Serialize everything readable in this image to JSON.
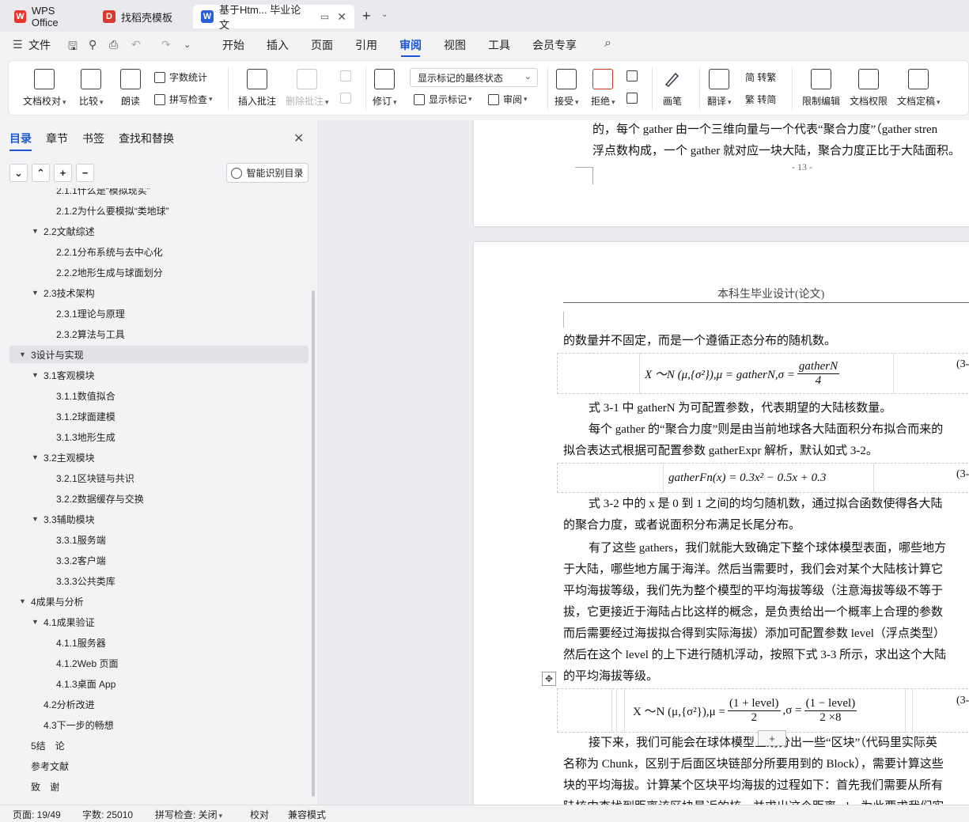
{
  "tabs": [
    {
      "label": "WPS Office",
      "icon": "wps-logo-icon"
    },
    {
      "label": "找稻壳模板",
      "icon": "docer-logo-icon"
    },
    {
      "label": "基于Htm... 毕业论文",
      "icon": "word-doc-icon"
    }
  ],
  "menu": {
    "file": "文件",
    "items": [
      "开始",
      "插入",
      "页面",
      "引用",
      "审阅",
      "视图",
      "工具",
      "会员专享"
    ],
    "active": "审阅"
  },
  "ribbon": {
    "doc_proofread": "文档校对",
    "compare": "比较",
    "read_aloud": "朗读",
    "word_count": "字数统计",
    "spell_check": "拼写检查",
    "insert_comment": "插入批注",
    "delete_comment": "删除批注",
    "revise": "修订",
    "markup_mode": "显示标记的最终状态",
    "show_markup": "显示标记",
    "review": "审阅",
    "accept": "接受",
    "reject": "拒绝",
    "pen": "画笔",
    "translate": "翻译",
    "to_traditional": "简 转繁",
    "to_simplified": "繁 转简",
    "restrict_edit": "限制编辑",
    "doc_permission": "文档权限",
    "doc_finalize": "文档定稿"
  },
  "sidebar": {
    "tabs": [
      "目录",
      "章节",
      "书签",
      "查找和替换"
    ],
    "active_tab": "目录",
    "smart_toc": "智能识别目录",
    "toc": [
      {
        "label": "2.1.1什么是“模拟现实”",
        "level": 3
      },
      {
        "label": "2.1.2为什么要模拟“类地球”",
        "level": 3
      },
      {
        "label": "2.2文献综述",
        "level": 2,
        "expanded": true
      },
      {
        "label": "2.2.1分布系统与去中心化",
        "level": 3
      },
      {
        "label": "2.2.2地形生成与球面划分",
        "level": 3
      },
      {
        "label": "2.3技术架构",
        "level": 2,
        "expanded": true
      },
      {
        "label": "2.3.1理论与原理",
        "level": 3
      },
      {
        "label": "2.3.2算法与工具",
        "level": 3
      },
      {
        "label": "3设计与实现",
        "level": 1,
        "expanded": true,
        "selected": true
      },
      {
        "label": "3.1客观模块",
        "level": 2,
        "expanded": true
      },
      {
        "label": "3.1.1数值拟合",
        "level": 3
      },
      {
        "label": "3.1.2球面建模",
        "level": 3
      },
      {
        "label": "3.1.3地形生成",
        "level": 3
      },
      {
        "label": "3.2主观模块",
        "level": 2,
        "expanded": true
      },
      {
        "label": "3.2.1区块链与共识",
        "level": 3
      },
      {
        "label": "3.2.2数据缓存与交换",
        "level": 3
      },
      {
        "label": "3.3辅助模块",
        "level": 2,
        "expanded": true
      },
      {
        "label": "3.3.1服务端",
        "level": 3
      },
      {
        "label": "3.3.2客户端",
        "level": 3
      },
      {
        "label": "3.3.3公共类库",
        "level": 3
      },
      {
        "label": "4成果与分析",
        "level": 1,
        "expanded": true
      },
      {
        "label": "4.1成果验证",
        "level": 2,
        "expanded": true
      },
      {
        "label": "4.1.1服务器",
        "level": 3
      },
      {
        "label": "4.1.2Web 页面",
        "level": 3
      },
      {
        "label": "4.1.3桌面 App",
        "level": 3
      },
      {
        "label": "4.2分析改进",
        "level": 2
      },
      {
        "label": "4.3下一步的畅想",
        "level": 2
      },
      {
        "label": "5结　论",
        "level": 1
      },
      {
        "label": "参考文献",
        "level": 1
      },
      {
        "label": "致　谢",
        "level": 1
      }
    ]
  },
  "document": {
    "page1_lines": [
      "的，每个 gather 由一个三维向量与一个代表“聚合力度”（gather stren",
      "浮点数构成，一个 gather 就对应一块大陆，聚合力度正比于大陆面积。"
    ],
    "page1_number": "- 13 -",
    "page2_header": "本科生毕业设计(论文)",
    "line_a": "的数量并不固定，而是一个遵循正态分布的随机数。",
    "eq1": {
      "left": "X ～N (μ,{σ²}),μ = gatherN,σ =",
      "num": "gatherN",
      "den": "4",
      "no": "(3-"
    },
    "para1": "式 3-1 中 gatherN 为可配置参数，代表期望的大陆核数量。",
    "para2_lines": [
      "每个 gather 的“聚合力度”则是由当前地球各大陆面积分布拟合而来的",
      "拟合表达式根据可配置参数 gatherExpr 解析，默认如式 3-2。"
    ],
    "eq2": {
      "text": "gatherFn(x) =  0.3x² −  0.5x  +  0.3",
      "no": "(3-"
    },
    "para3_lines": [
      "式 3-2 中的 x 是 0 到 1 之间的均匀随机数，通过拟合函数使得各大陆",
      "的聚合力度，或者说面积分布满足长尾分布。"
    ],
    "para4_lines": [
      "有了这些 gathers，我们就能大致确定下整个球体模型表面，哪些地方",
      "于大陆，哪些地方属于海洋。然后当需要时，我们会对某个大陆核计算它",
      "平均海拔等级，我们先为整个模型的平均海拔等级（注意海拔等级不等于",
      "拔，它更接近于海陆占比这样的概念，是负责给出一个概率上合理的参数",
      "而后需要经过海拔拟合得到实际海拔）添加可配置参数 level（浮点类型）",
      "然后在这个 level 的上下进行随机浮动，按照下式 3-3 所示，求出这个大陆",
      "的平均海拔等级。"
    ],
    "eq3": {
      "left": "X ～N (μ,{σ²}),μ =",
      "num1": "(1 + level)",
      "den1": "2",
      "mid": ",σ =",
      "num2": "(1 − level)",
      "den2": "2 ×8",
      "no": "(3-"
    },
    "para5_lines": [
      "接下来，我们可能会在球体模型上划分出一些“区块”（代码里实际英",
      "名称为 Chunk，区别于后面区块链部分所要用到的 Block），需要计算这些",
      "块的平均海拔。计算某个区块平均海拔的过程如下：首先我们需要从所有",
      "陆核中查找到距离该区块最近的核，并求出这个距离 rd，为此要求我们实"
    ]
  },
  "status": {
    "page": "页面: 19/49",
    "words": "字数: 25010",
    "spell": "拼写检查: 关闭",
    "proof": "校对",
    "compat": "兼容模式"
  },
  "colors": {
    "accent": "#1a56d6",
    "wps_red": "#e8352c",
    "word_blue": "#2b5fd9"
  }
}
